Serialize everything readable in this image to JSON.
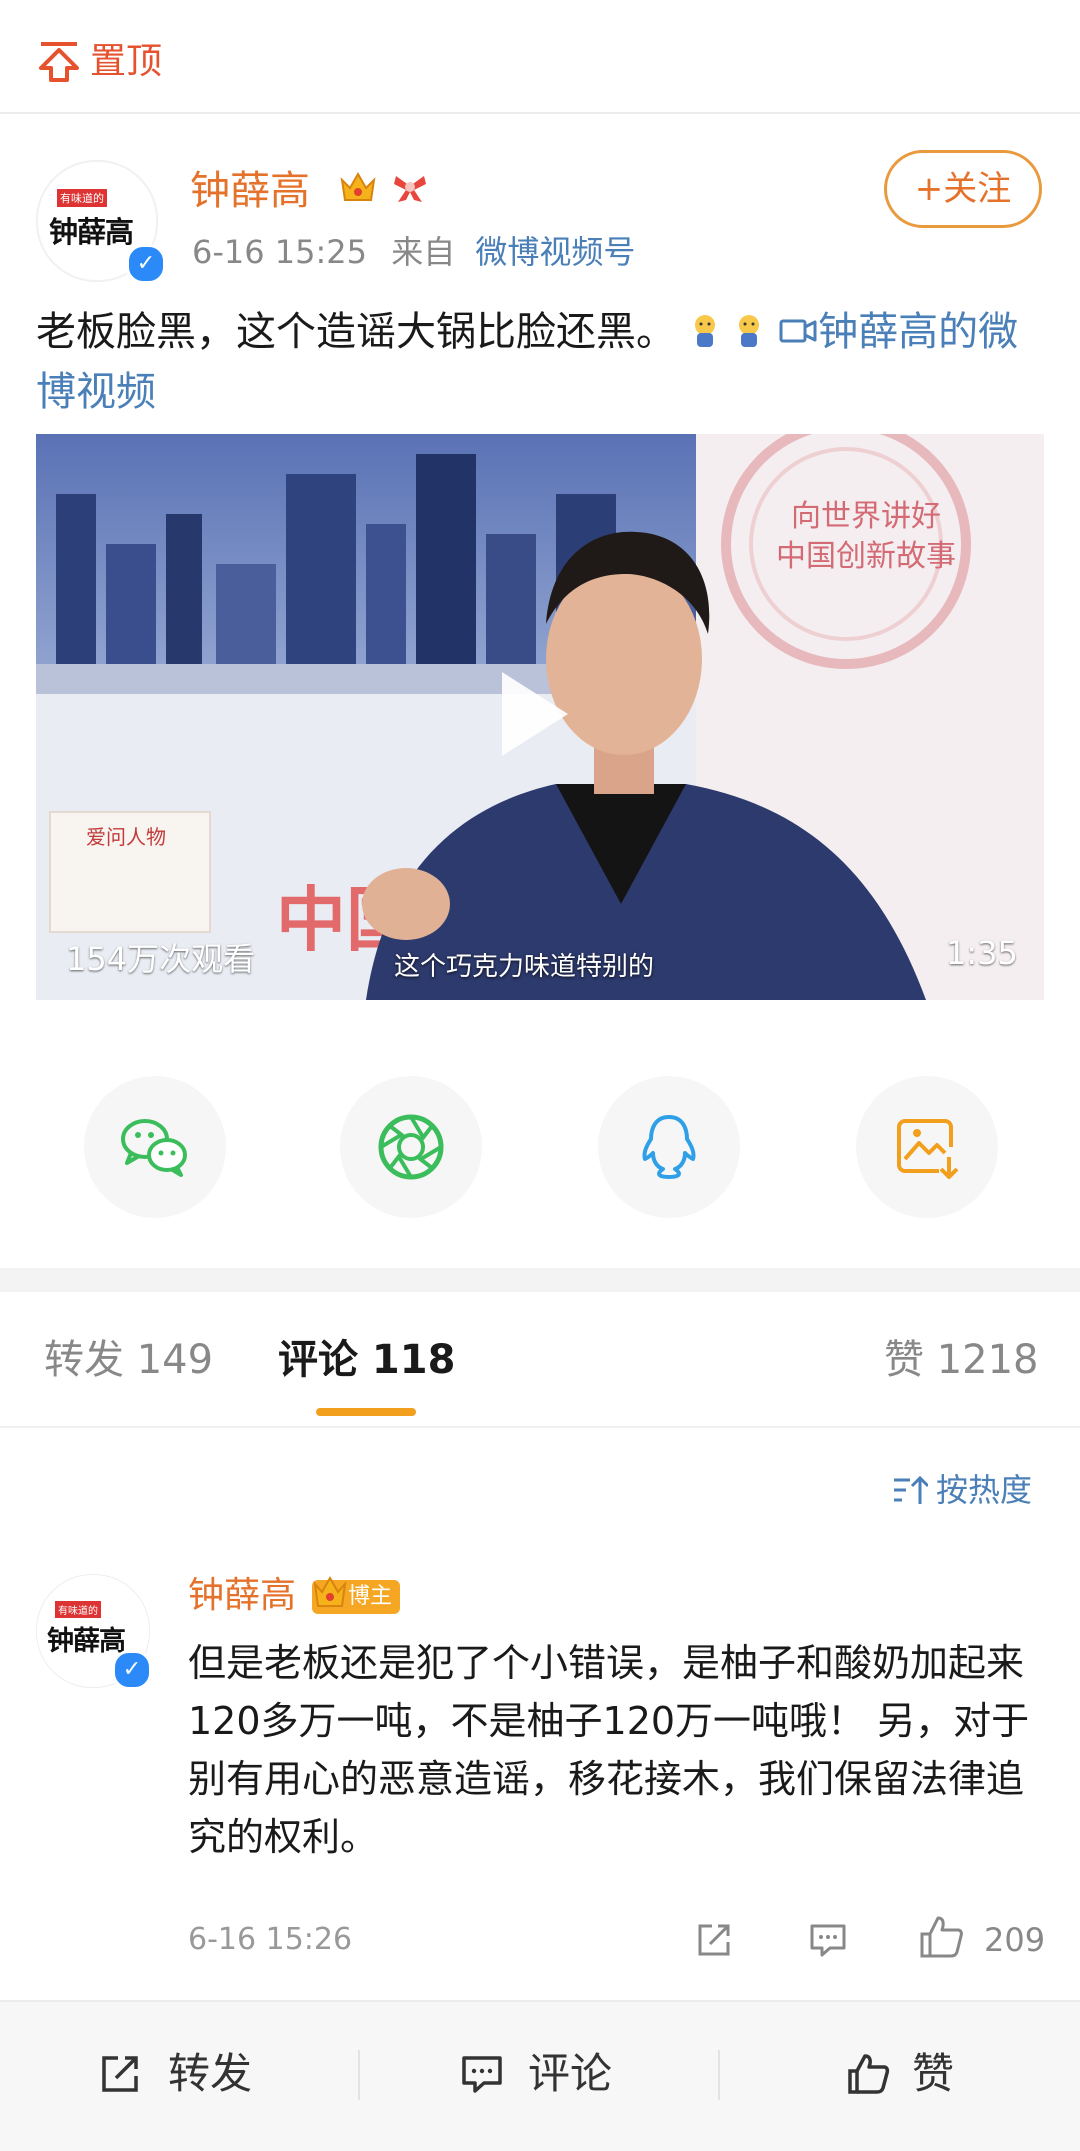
{
  "pin": {
    "label": "置顶"
  },
  "post": {
    "avatar_text": "钟薛高",
    "avatar_tag": "有味道的",
    "author": "钟薛高",
    "time": "6-16 15:25",
    "source_prefix": "来自",
    "source": "微博视频号",
    "follow_label": "+关注",
    "text": "老板脸黑，这个造谣大锅比脸还黑。",
    "link_text": "钟薛高的微博视频"
  },
  "video": {
    "views": "154万次观看",
    "duration": "1:35",
    "subtitle": "这个巧克力味道特别的",
    "background_sign": "向世界讲好中国创新故事",
    "book_title": "爱问人物",
    "banner_text": "中国"
  },
  "share": {
    "items": [
      {
        "icon": "wechat-icon",
        "color": "#3bbd5c"
      },
      {
        "icon": "moments-icon",
        "color": "#3bbd5c"
      },
      {
        "icon": "qq-icon",
        "color": "#2f9fe8"
      },
      {
        "icon": "save-image-icon",
        "color": "#f29f1e"
      }
    ]
  },
  "tabs": {
    "repost": "转发 149",
    "comments": "评论 118",
    "likes": "赞 1218"
  },
  "sort": {
    "label": "按热度"
  },
  "comment": {
    "avatar_text": "钟薛高",
    "avatar_tag": "有味道的",
    "author": "钟薛高",
    "badge": "博主",
    "text": "但是老板还是犯了个小错误，是柚子和酸奶加起来120多万一吨，不是柚子120万一吨哦！ 另，对于别有用心的恶意造谣，移花接木，我们保留法律追究的权利。",
    "time": "6-16 15:26",
    "likes": "209"
  },
  "bottom_bar": {
    "repost": "转发",
    "comment": "评论",
    "like": "赞"
  },
  "colors": {
    "accent_orange": "#e5722b",
    "link_blue": "#4a7fb8",
    "tab_underline": "#f29f1e"
  }
}
